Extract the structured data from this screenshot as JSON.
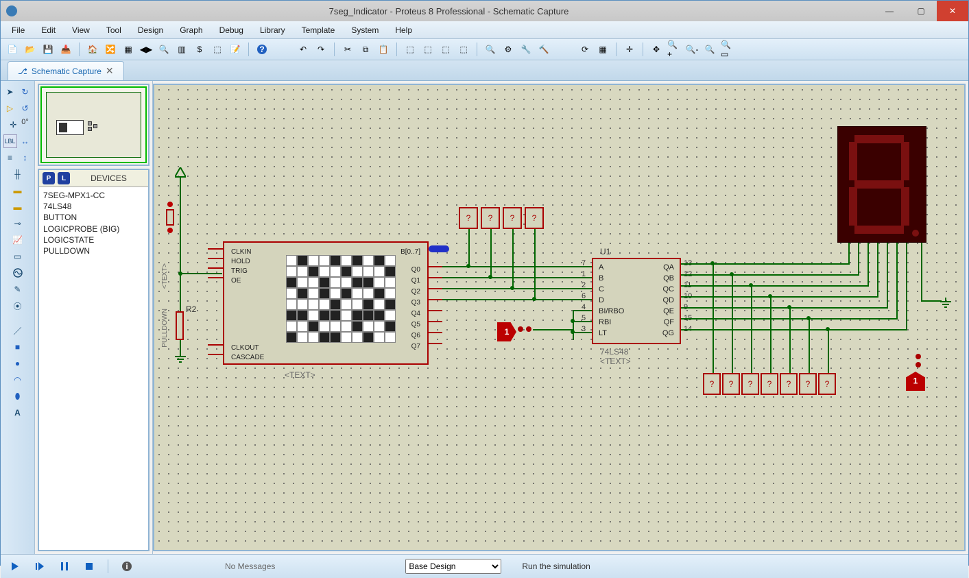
{
  "window": {
    "title": "7seg_Indicator - Proteus 8 Professional - Schematic Capture"
  },
  "menu": [
    "File",
    "Edit",
    "View",
    "Tool",
    "Design",
    "Graph",
    "Debug",
    "Library",
    "Template",
    "System",
    "Help"
  ],
  "tab": {
    "title": "Schematic Capture"
  },
  "angle": "0°",
  "devicesHeader": {
    "p": "P",
    "l": "L",
    "label": "DEVICES"
  },
  "devices": [
    "7SEG-MPX1-CC",
    "74LS48",
    "BUTTON",
    "LOGICPROBE (BIG)",
    "LOGICSTATE",
    "PULLDOWN"
  ],
  "patgen": {
    "leftPins": [
      "CLKIN",
      "HOLD",
      "TRIG",
      "OE"
    ],
    "bottomPins": [
      "CLKOUT",
      "CASCADE"
    ],
    "bus": "B[0..7]",
    "outs": [
      "Q0",
      "Q1",
      "Q2",
      "Q3",
      "Q4",
      "Q5",
      "Q6",
      "Q7"
    ],
    "text": "<TEXT>",
    "r2": "R2",
    "pulldown": "PULLDOWN",
    "sideText": "<TEXT>"
  },
  "u1": {
    "ref": "U1",
    "part": "74LS48",
    "text": "<TEXT>",
    "leftPins": [
      {
        "n": "7",
        "name": "A"
      },
      {
        "n": "1",
        "name": "B"
      },
      {
        "n": "2",
        "name": "C"
      },
      {
        "n": "6",
        "name": "D"
      },
      {
        "n": "4",
        "name": "BI/RBO"
      },
      {
        "n": "5",
        "name": "RBI"
      },
      {
        "n": "3",
        "name": "LT"
      }
    ],
    "rightPins": [
      {
        "n": "13",
        "name": "QA"
      },
      {
        "n": "12",
        "name": "QB"
      },
      {
        "n": "11",
        "name": "QC"
      },
      {
        "n": "10",
        "name": "QD"
      },
      {
        "n": "9",
        "name": "QE"
      },
      {
        "n": "15",
        "name": "QF"
      },
      {
        "n": "14",
        "name": "QG"
      }
    ]
  },
  "logicstate1": "1",
  "logicstateRight": "1",
  "statusbar": {
    "messages": "No Messages",
    "design": "Base Design",
    "runtext": "Run the simulation"
  }
}
